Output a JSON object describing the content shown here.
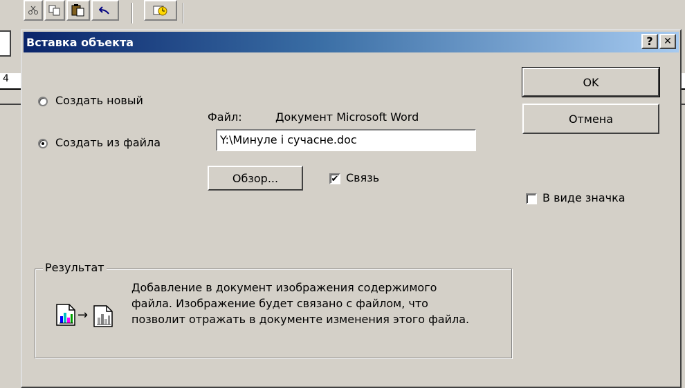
{
  "dialog": {
    "title": "Вставка объекта",
    "help_label": "?",
    "close_label": "✕"
  },
  "options": {
    "create_new": "Создать новый",
    "create_from_file": "Создать из файла",
    "selected": "create_from_file"
  },
  "file": {
    "label": "Файл:",
    "type": "Документ Microsoft Word",
    "path": "Y:\\Минуле і сучасне.doc"
  },
  "buttons": {
    "ok": "OK",
    "cancel": "Отмена",
    "browse": "Обзор..."
  },
  "link": {
    "label": "Связь",
    "checked": true
  },
  "as_icon": {
    "label": "В виде значка",
    "checked": false
  },
  "result": {
    "legend": "Результат",
    "text": "Добавление в документ изображения содержимого файла.  Изображение будет связано с файлом, что позволит отражать в документе изменения этого файла."
  },
  "background": {
    "ruler_left_number": "4"
  },
  "icons": {
    "toolbar": [
      "cut-icon",
      "copy-icon",
      "paste-icon",
      "undo-icon",
      "web-toolbar-icon"
    ],
    "result": [
      "document-chart-icon",
      "arrow-icon",
      "linked-document-icon"
    ]
  }
}
